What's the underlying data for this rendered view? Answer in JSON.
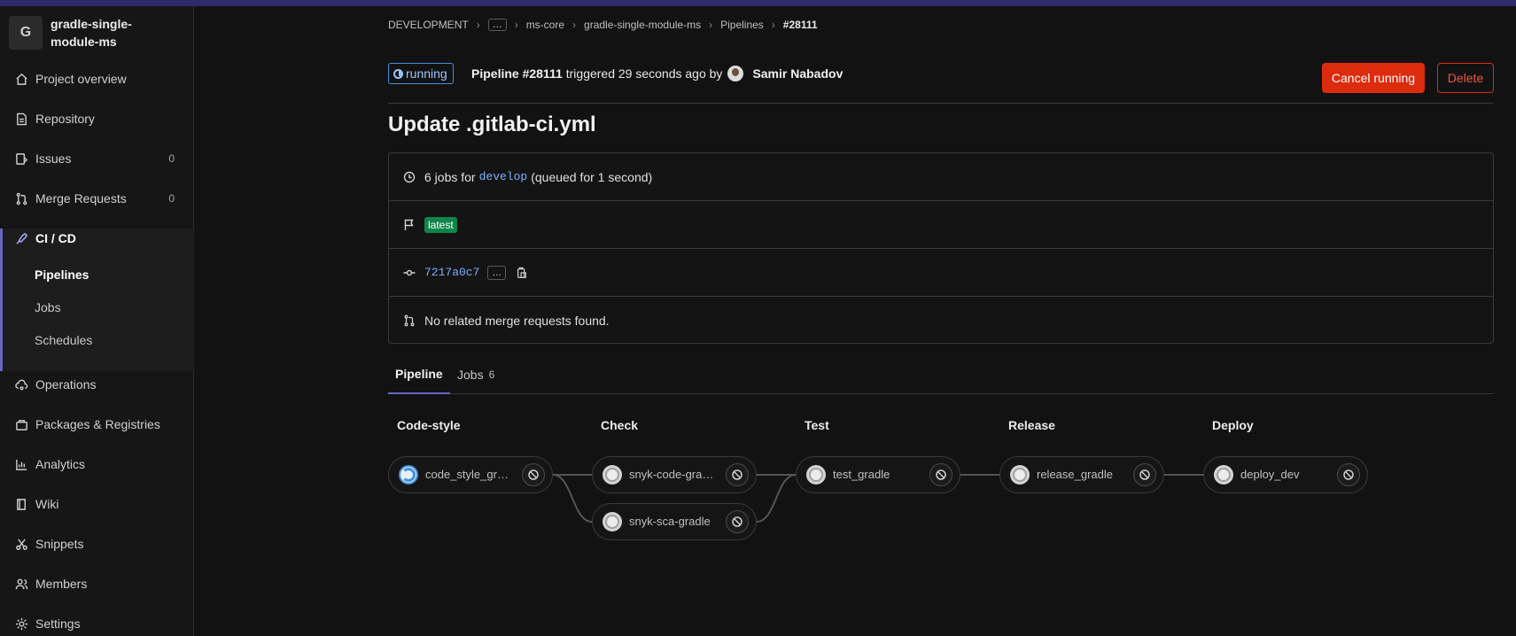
{
  "project": {
    "avatar_letter": "G",
    "name": "gradle-single-module-ms"
  },
  "sidebar": {
    "items": [
      {
        "label": "Project overview",
        "icon": "home-icon"
      },
      {
        "label": "Repository",
        "icon": "document-icon"
      },
      {
        "label": "Issues",
        "icon": "issues-icon",
        "count": "0"
      },
      {
        "label": "Merge Requests",
        "icon": "merge-request-icon",
        "count": "0"
      },
      {
        "label": "CI / CD",
        "icon": "rocket-icon"
      },
      {
        "label": "Operations",
        "icon": "cloud-gear-icon"
      },
      {
        "label": "Packages & Registries",
        "icon": "package-icon"
      },
      {
        "label": "Analytics",
        "icon": "chart-icon"
      },
      {
        "label": "Wiki",
        "icon": "book-icon"
      },
      {
        "label": "Snippets",
        "icon": "scissors-icon"
      },
      {
        "label": "Members",
        "icon": "users-icon"
      },
      {
        "label": "Settings",
        "icon": "gear-icon"
      }
    ],
    "cicd_sub": [
      "Pipelines",
      "Jobs",
      "Schedules"
    ]
  },
  "breadcrumb": {
    "items": [
      "DEVELOPMENT",
      "…",
      "ms-core",
      "gradle-single-module-ms",
      "Pipelines"
    ],
    "current": "#28111"
  },
  "header": {
    "status": "running",
    "pipeline_label": "Pipeline #28111",
    "triggered_text": "triggered 29 seconds ago by",
    "user": "Samir Nabadov",
    "cancel_label": "Cancel running",
    "delete_label": "Delete"
  },
  "commit_title": "Update .gitlab-ci.yml",
  "info": {
    "jobs_prefix": "6 jobs for",
    "branch": "develop",
    "queued_text": "(queued for 1 second)",
    "badge": "latest",
    "sha": "7217a0c7",
    "more": "…",
    "merge_text": "No related merge requests found."
  },
  "tabs": [
    {
      "label": "Pipeline"
    },
    {
      "label": "Jobs",
      "count": "6"
    }
  ],
  "stages": [
    {
      "name": "Code-style",
      "jobs": [
        {
          "name": "code_style_gradle",
          "status": "running"
        }
      ]
    },
    {
      "name": "Check",
      "jobs": [
        {
          "name": "snyk-code-gradle",
          "status": "created"
        },
        {
          "name": "snyk-sca-gradle",
          "status": "created"
        }
      ]
    },
    {
      "name": "Test",
      "jobs": [
        {
          "name": "test_gradle",
          "status": "created"
        }
      ]
    },
    {
      "name": "Release",
      "jobs": [
        {
          "name": "release_gradle",
          "status": "created"
        }
      ]
    },
    {
      "name": "Deploy",
      "jobs": [
        {
          "name": "deploy_dev",
          "status": "created"
        }
      ]
    }
  ],
  "colors": {
    "accent": "#6666c4",
    "running": "#428fdc",
    "danger": "#dd2b0e",
    "success_badge": "#108548",
    "link": "#7ab0ff"
  }
}
